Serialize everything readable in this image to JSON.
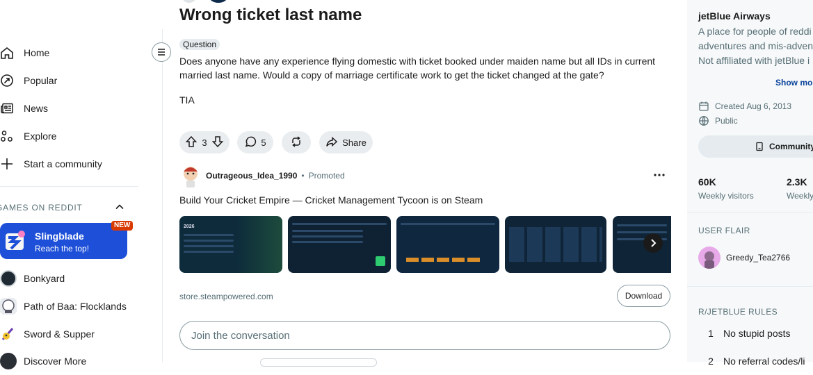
{
  "nav": {
    "items": [
      {
        "label": "Home",
        "icon": "home-icon"
      },
      {
        "label": "Popular",
        "icon": "popular-icon"
      },
      {
        "label": "News",
        "icon": "news-icon"
      },
      {
        "label": "Explore",
        "icon": "explore-icon"
      },
      {
        "label": "Start a community",
        "icon": "plus-icon"
      }
    ],
    "games_header": "GAMES ON REDDIT",
    "featured_game": {
      "title": "Slingblade",
      "subtitle": "Reach the top!",
      "badge": "NEW"
    },
    "games": [
      {
        "label": "Bonkyard"
      },
      {
        "label": "Path of Baa: Flocklands"
      },
      {
        "label": "Sword & Supper"
      },
      {
        "label": "Discover More"
      }
    ]
  },
  "post": {
    "title": "Wrong ticket last name",
    "flair": "Question",
    "body": "Does anyone have any experience flying domestic with ticket booked under maiden name but all IDs in current married last name. Would a copy of marriage certificate work to get the ticket changed at the gate?",
    "body2": "TIA",
    "votes": "3",
    "comments": "5",
    "share_label": "Share"
  },
  "ad": {
    "user": "Outrageous_Idea_1990",
    "sep": "•",
    "promoted": "Promoted",
    "headline": "Build Your Cricket Empire — Cricket Management Tycoon is on Steam",
    "domain": "store.steampowered.com",
    "download_label": "Download",
    "thumb_year": "2026"
  },
  "comment_box": {
    "placeholder": "Join the conversation"
  },
  "sidebar": {
    "title": "jetBlue Airways",
    "desc1": "A place for people of reddi",
    "desc2": "adventures and mis-advent",
    "desc3": "Not affiliated with jetBlue i",
    "show_more": "Show mor",
    "created": "Created Aug 6, 2013",
    "visibility": "Public",
    "community_btn": "Community",
    "stat1_value": "60K",
    "stat1_label": "Weekly visitors",
    "stat2_value": "2.3K",
    "stat2_label": "Weekly",
    "flair_header": "USER FLAIR",
    "flair_user": "Greedy_Tea2766",
    "rules_header": "R/JETBLUE RULES",
    "rules": [
      {
        "num": "1",
        "text": "No stupid posts"
      },
      {
        "num": "2",
        "text": "No referral codes/li"
      }
    ]
  },
  "colors": {
    "accent": "#0045ac",
    "promo_blue": "#1d4fd8",
    "badge_red": "#d93a00",
    "link": "#0a449b"
  }
}
